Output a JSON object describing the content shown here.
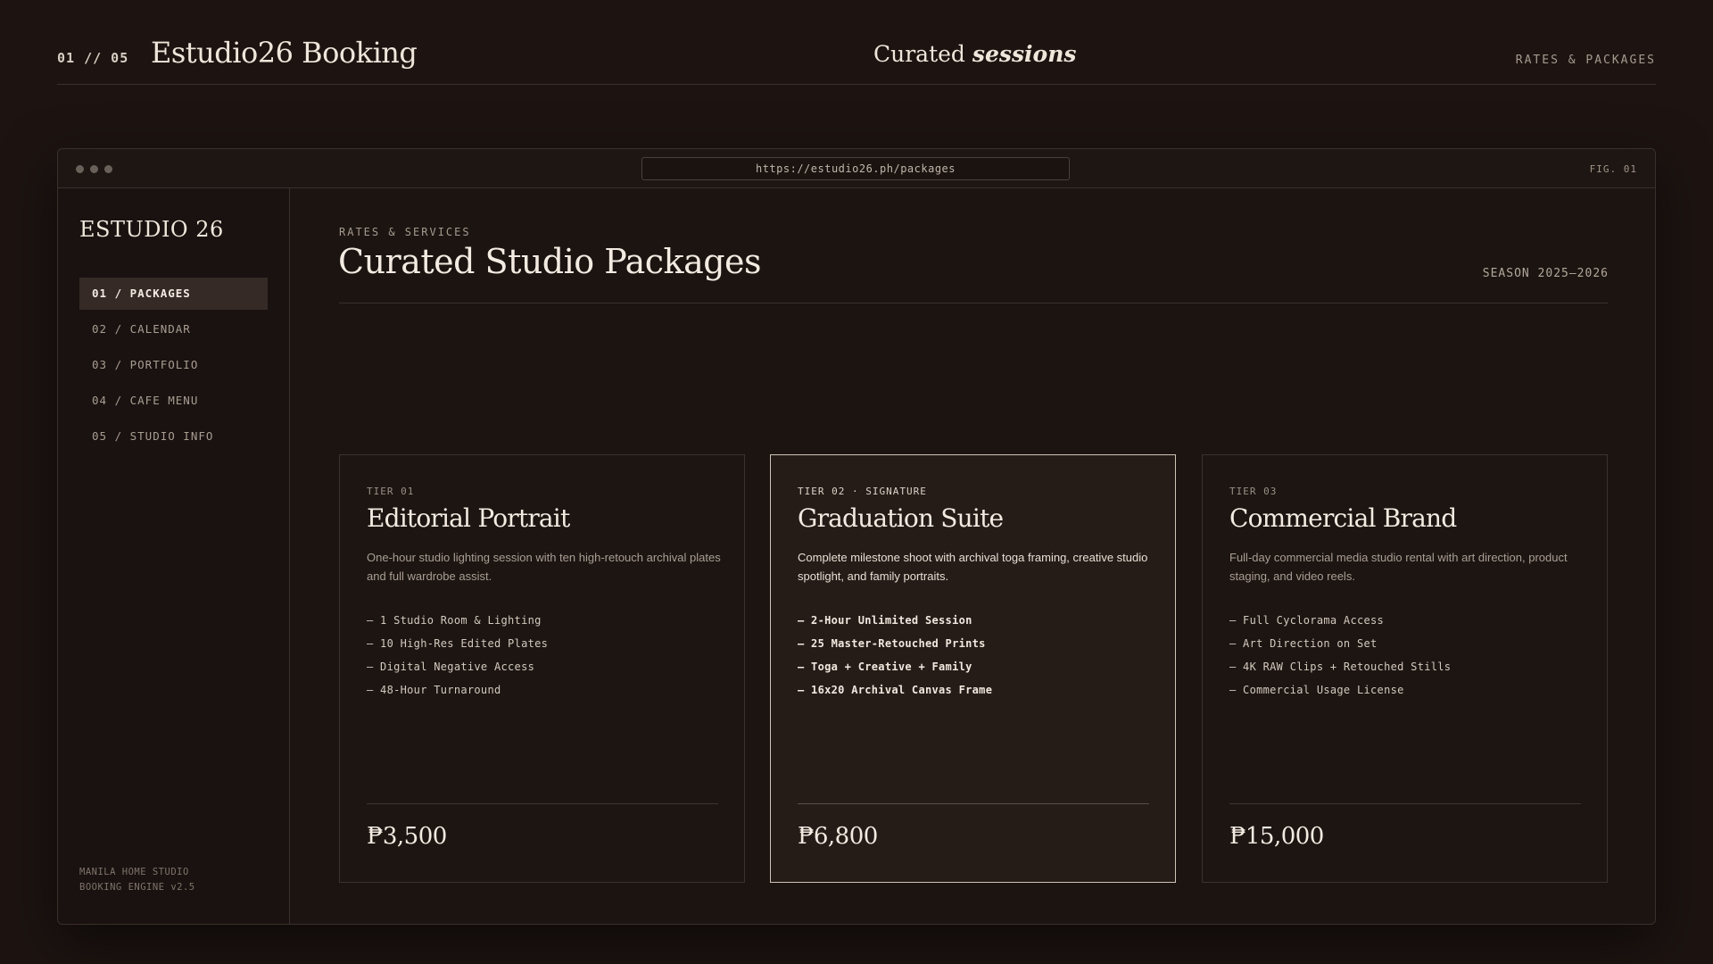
{
  "header": {
    "counter": "01 // 05",
    "brand": "Estudio26 Booking",
    "title_plain": "Curated",
    "title_em": "sessions",
    "right_label": "RATES & PACKAGES"
  },
  "browser": {
    "url": "https://estudio26.ph/packages",
    "fig_label": "FIG. 01"
  },
  "sidebar": {
    "logo": "ESTUDIO 26",
    "items": [
      {
        "label": "01 / PACKAGES",
        "active": true
      },
      {
        "label": "02 / CALENDAR",
        "active": false
      },
      {
        "label": "03 / PORTFOLIO",
        "active": false
      },
      {
        "label": "04 / CAFE MENU",
        "active": false
      },
      {
        "label": "05 / STUDIO INFO",
        "active": false
      }
    ],
    "footer_line1": "MANILA HOME STUDIO",
    "footer_line2": "BOOKING ENGINE v2.5"
  },
  "main": {
    "eyebrow": "RATES & SERVICES",
    "title": "Curated Studio Packages",
    "season": "SEASON 2025–2026"
  },
  "packages": [
    {
      "tier": "TIER 01",
      "name": "Editorial Portrait",
      "description": "One-hour studio lighting session with ten high-retouch archival plates and full wardrobe assist.",
      "features": [
        "— 1 Studio Room & Lighting",
        "— 10 High-Res Edited Plates",
        "— Digital Negative Access",
        "— 48-Hour Turnaround"
      ],
      "price": "₱3,500",
      "featured": false
    },
    {
      "tier": "TIER 02 · SIGNATURE",
      "name": "Graduation Suite",
      "description": "Complete milestone shoot with archival toga framing, creative studio spotlight, and family portraits.",
      "features": [
        "— 2-Hour Unlimited Session",
        "— 25 Master-Retouched Prints",
        "— Toga + Creative + Family",
        "— 16x20 Archival Canvas Frame"
      ],
      "price": "₱6,800",
      "featured": true
    },
    {
      "tier": "TIER 03",
      "name": "Commercial Brand",
      "description": "Full-day commercial media studio rental with art direction, product staging, and video reels.",
      "features": [
        "— Full Cyclorama Access",
        "— Art Direction on Set",
        "— 4K RAW Clips + Retouched Stills",
        "— Commercial Usage License"
      ],
      "price": "₱15,000",
      "featured": false
    }
  ]
}
